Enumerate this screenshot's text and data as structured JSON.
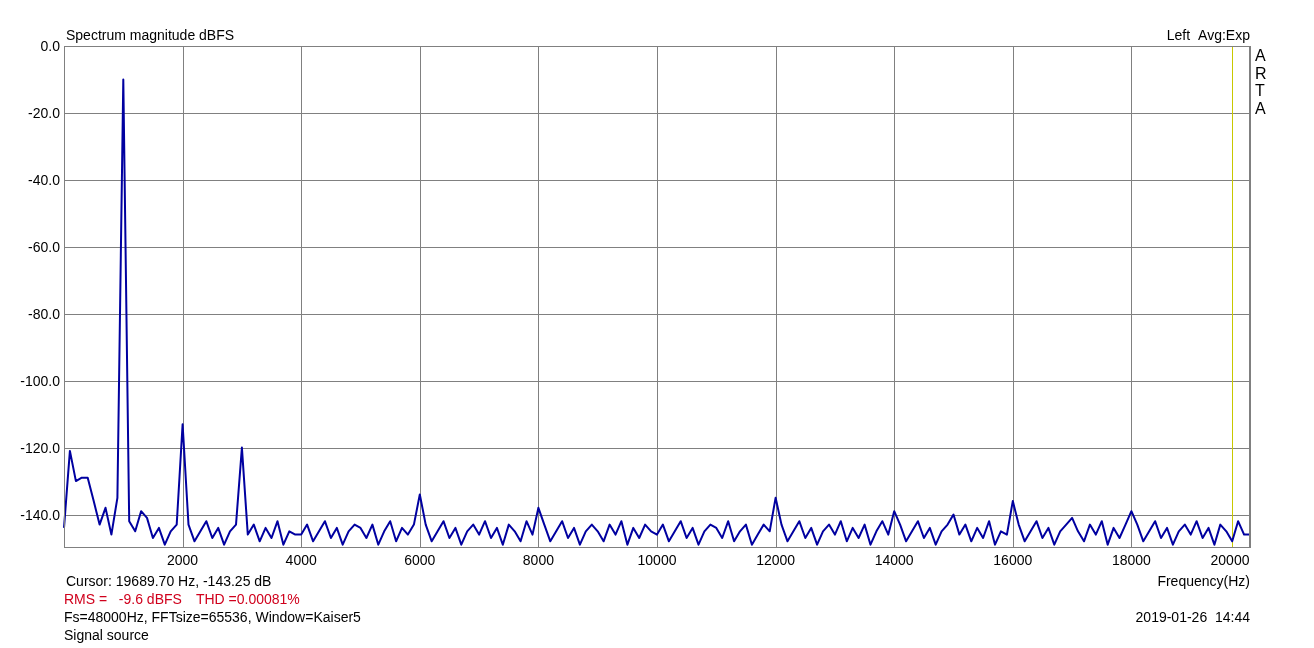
{
  "chart": {
    "title": "Spectrum magnitude dBFS",
    "status": "Avg:Exp",
    "brand": "ARTA",
    "chart_data": {
      "type": "line",
      "grid": true,
      "xlabel": "Frequency(Hz)",
      "xlim": [
        0,
        20000
      ],
      "ylim": [
        -150,
        0
      ],
      "xticks": [
        2000,
        4000,
        6000,
        8000,
        10000,
        12000,
        14000,
        16000,
        18000,
        20000
      ],
      "yticks": [
        {
          "value": 0,
          "label": "0.0"
        },
        {
          "value": -20,
          "label": "-20.0"
        },
        {
          "value": -40,
          "label": "-40.0"
        },
        {
          "value": -60,
          "label": "-60.0"
        },
        {
          "value": -80,
          "label": "-80.0"
        },
        {
          "value": -100,
          "label": "-100.0"
        },
        {
          "value": -120,
          "label": "-120.0"
        },
        {
          "value": -140,
          "label": "-140.0"
        }
      ],
      "x": [
        0,
        100,
        200,
        300,
        400,
        500,
        600,
        700,
        800,
        900,
        1000,
        1100,
        1200,
        1300,
        1400,
        1500,
        1600,
        1700,
        1800,
        1900,
        2000,
        2100,
        2200,
        2300,
        2400,
        2500,
        2600,
        2700,
        2800,
        2900,
        3000,
        3100,
        3200,
        3300,
        3400,
        3500,
        3600,
        3700,
        3800,
        3900,
        4000,
        4100,
        4200,
        4300,
        4400,
        4500,
        4600,
        4700,
        4800,
        4900,
        5000,
        5100,
        5200,
        5300,
        5400,
        5500,
        5600,
        5700,
        5800,
        5900,
        6000,
        6100,
        6200,
        6300,
        6400,
        6500,
        6600,
        6700,
        6800,
        6900,
        7000,
        7100,
        7200,
        7300,
        7400,
        7500,
        7600,
        7700,
        7800,
        7900,
        8000,
        8100,
        8200,
        8300,
        8400,
        8500,
        8600,
        8700,
        8800,
        8900,
        9000,
        9100,
        9200,
        9300,
        9400,
        9500,
        9600,
        9700,
        9800,
        9900,
        10000,
        10100,
        10200,
        10300,
        10400,
        10500,
        10600,
        10700,
        10800,
        10900,
        11000,
        11100,
        11200,
        11300,
        11400,
        11500,
        11600,
        11700,
        11800,
        11900,
        12000,
        12100,
        12200,
        12300,
        12400,
        12500,
        12600,
        12700,
        12800,
        12900,
        13000,
        13100,
        13200,
        13300,
        13400,
        13500,
        13600,
        13700,
        13800,
        13900,
        14000,
        14100,
        14200,
        14300,
        14400,
        14500,
        14600,
        14700,
        14800,
        14900,
        15000,
        15100,
        15200,
        15300,
        15400,
        15500,
        15600,
        15700,
        15800,
        15900,
        16000,
        16100,
        16200,
        16300,
        16400,
        16500,
        16600,
        16700,
        16800,
        16900,
        17000,
        17100,
        17200,
        17300,
        17400,
        17500,
        17600,
        17700,
        17800,
        17900,
        18000,
        18100,
        18200,
        18300,
        18400,
        18500,
        18600,
        18700,
        18800,
        18900,
        19000,
        19100,
        19200,
        19300,
        19400,
        19500,
        19600,
        19700,
        19800,
        19900,
        20000
      ],
      "series": [
        {
          "name": "Left",
          "color": "#0000a0",
          "values": [
            -144,
            -121,
            -130,
            -129,
            -129,
            -136,
            -143,
            -138,
            -146,
            -135,
            -10,
            -142,
            -145,
            -139,
            -141,
            -147,
            -144,
            -149,
            -145,
            -143,
            -113,
            -143,
            -148,
            -145,
            -142,
            -147,
            -144,
            -149,
            -145,
            -143,
            -120,
            -146,
            -143,
            -148,
            -144,
            -147,
            -142,
            -149,
            -145,
            -146,
            -146,
            -143,
            -148,
            -145,
            -142,
            -147,
            -144,
            -149,
            -145,
            -143,
            -144,
            -147,
            -143,
            -149,
            -145,
            -142,
            -148,
            -144,
            -146,
            -143,
            -134,
            -143,
            -148,
            -145,
            -142,
            -147,
            -144,
            -149,
            -145,
            -143,
            -146,
            -142,
            -147,
            -144,
            -149,
            -143,
            -145,
            -148,
            -142,
            -146,
            -138,
            -143,
            -148,
            -145,
            -142,
            -147,
            -144,
            -149,
            -145,
            -143,
            -145,
            -148,
            -143,
            -146,
            -142,
            -149,
            -144,
            -147,
            -143,
            -145,
            -146,
            -143,
            -148,
            -145,
            -142,
            -147,
            -144,
            -149,
            -145,
            -143,
            -144,
            -147,
            -142,
            -148,
            -145,
            -143,
            -149,
            -146,
            -143,
            -145,
            -135,
            -143,
            -148,
            -145,
            -142,
            -147,
            -144,
            -149,
            -145,
            -143,
            -146,
            -142,
            -148,
            -144,
            -147,
            -143,
            -149,
            -145,
            -142,
            -146,
            -139,
            -143,
            -148,
            -145,
            -142,
            -147,
            -144,
            -149,
            -145,
            -143,
            -140,
            -146,
            -143,
            -148,
            -144,
            -147,
            -142,
            -149,
            -145,
            -146,
            -136,
            -143,
            -148,
            -145,
            -142,
            -147,
            -144,
            -149,
            -145,
            -143,
            -141,
            -145,
            -148,
            -143,
            -146,
            -142,
            -149,
            -144,
            -147,
            -143,
            -139,
            -143,
            -148,
            -145,
            -142,
            -147,
            -144,
            -149,
            -145,
            -143,
            -146,
            -142,
            -147,
            -144,
            -149,
            -143,
            -145,
            -148,
            -142,
            -146,
            -146
          ]
        }
      ],
      "ref_lines": [
        {
          "axis": "x",
          "value": 19689.7,
          "color": "#c8c800"
        }
      ]
    }
  },
  "footer": {
    "cursor": "Cursor: 19689.70 Hz, -143.25 dB",
    "rms": "RMS =   -9.6 dBFS",
    "thd": "THD =0.00081%",
    "settings": "Fs=48000Hz, FFTsize=65536, Window=Kaiser5",
    "source": "Signal source",
    "timestamp": "2019-01-26  14:44"
  }
}
